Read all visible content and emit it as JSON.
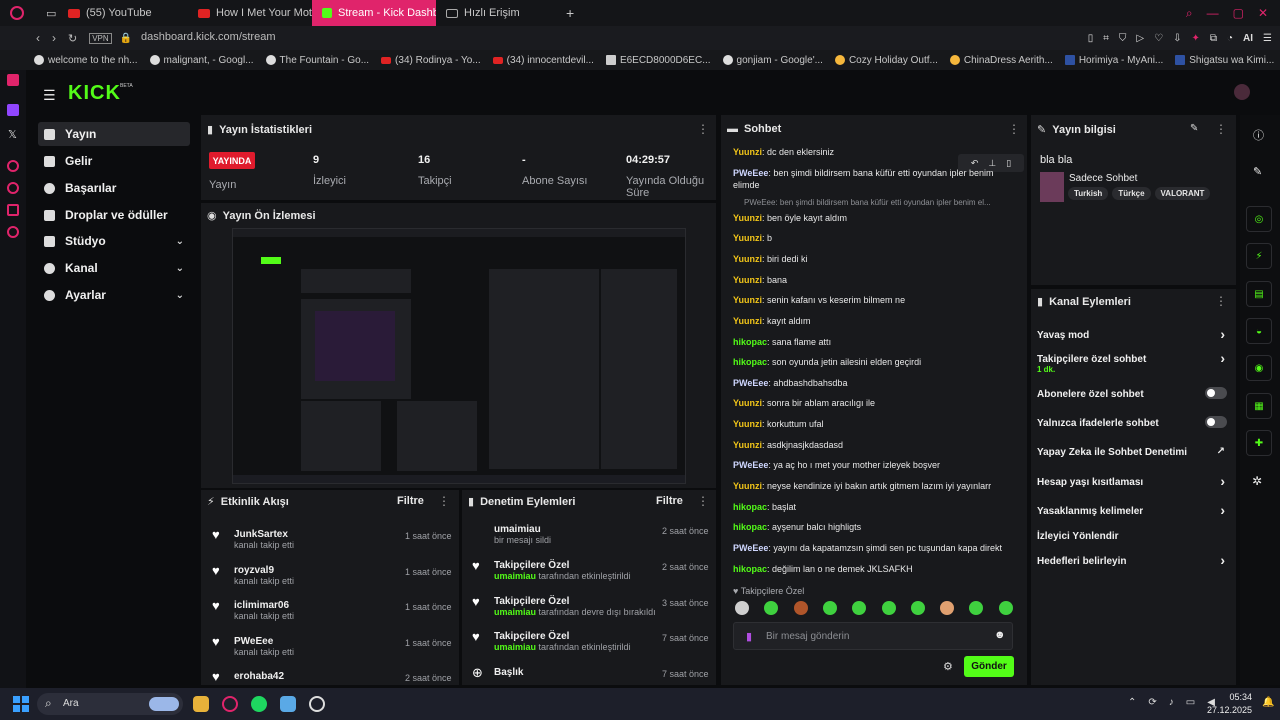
{
  "browser": {
    "tabs": [
      "(55) YouTube",
      "How I Met Your Mother 2...",
      "Stream - Kick Dashbo...",
      "Hızlı Erişim"
    ],
    "url": "dashboard.kick.com/stream",
    "vpn": "VPN",
    "ai": "AI"
  },
  "bookmarks": [
    "welcome to the nh...",
    "malignant, - Googl...",
    "The Fountain - Go...",
    "(34) Rodinya - Yo...",
    "(34) innocentdevil...",
    "E6ECD8000D6EC...",
    "gonjiam - Google'...",
    "Cozy Holiday Outf...",
    "ChinaDress Aerith...",
    "Horimiya - MyAni...",
    "Shigatsu wa Kimi..."
  ],
  "brand": {
    "logo": "KICK",
    "beta": "BETA",
    "accent": "#53fc18"
  },
  "sidebar": {
    "items": [
      {
        "label": "Yayın",
        "icon": "video-icon"
      },
      {
        "label": "Gelir",
        "icon": "chart-icon"
      },
      {
        "label": "Başarılar",
        "icon": "trophy-icon"
      },
      {
        "label": "Droplar ve ödüller",
        "icon": "gift-icon"
      },
      {
        "label": "Stüdyo",
        "icon": "camera-icon"
      },
      {
        "label": "Kanal",
        "icon": "user-icon"
      },
      {
        "label": "Ayarlar",
        "icon": "gear-icon"
      }
    ]
  },
  "stats": {
    "title": "Yayın İstatistikleri",
    "live_badge": "YAYINDA",
    "stream_label": "Yayın",
    "viewers_value": "9",
    "viewers_label": "İzleyici",
    "followers_value": "16",
    "followers_label": "Takipçi",
    "subs_value": "-",
    "subs_label": "Abone Sayısı",
    "duration_value": "04:29:57",
    "duration_label": "Yayında Olduğu Süre"
  },
  "preview": {
    "title": "Yayın Ön İzlemesi"
  },
  "activity": {
    "title": "Etkinlik Akışı",
    "filter": "Filtre",
    "items": [
      {
        "name": "JunkSartex",
        "sub": "kanalı takip etti",
        "time": "1 saat önce"
      },
      {
        "name": "royzval9",
        "sub": "kanalı takip etti",
        "time": "1 saat önce"
      },
      {
        "name": "iclimimar06",
        "sub": "kanalı takip etti",
        "time": "1 saat önce"
      },
      {
        "name": "PWeEee",
        "sub": "kanalı takip etti",
        "time": "1 saat önce"
      },
      {
        "name": "erohaba42",
        "sub": "",
        "time": "2 saat önce"
      }
    ]
  },
  "moderation": {
    "title": "Denetim Eylemleri",
    "filter": "Filtre",
    "items": [
      {
        "name": "umaimiau",
        "sub_user": "",
        "sub": "bir mesajı sildi",
        "time": "2 saat önce"
      },
      {
        "name": "Takipçilere Özel",
        "sub_user": "umaimiau",
        "sub": " tarafından etkinleştirildi",
        "time": "2 saat önce"
      },
      {
        "name": "Takipçilere Özel",
        "sub_user": "umaimiau",
        "sub": " tarafından devre dışı bırakıldı",
        "time": "3 saat önce"
      },
      {
        "name": "Takipçilere Özel",
        "sub_user": "umaimiau",
        "sub": " tarafından etkinleştirildi",
        "time": "7 saat önce"
      },
      {
        "name": "Başlık",
        "sub_user": "",
        "sub": "",
        "time": "7 saat önce"
      }
    ]
  },
  "chat": {
    "title": "Sohbet",
    "reply_preview": "PWeEee: ben şimdi bildirsem bana küfür etti oyundan ipler benim el...",
    "followers_only": "Takipçilere Özel",
    "placeholder": "Bir mesaj gönderin",
    "send": "Gönder",
    "messages": [
      {
        "user": "Yuunzi",
        "color": "y",
        "text": "dc den eklersiniz"
      },
      {
        "user": "PWeEee",
        "color": "w",
        "text": "ben şimdi bildirsem bana küfür etti oyundan ipler benim elimde"
      },
      {
        "user": "Yuunzi",
        "color": "y",
        "text": "ben öyle kayıt aldım"
      },
      {
        "user": "Yuunzi",
        "color": "y",
        "text": "b"
      },
      {
        "user": "Yuunzi",
        "color": "y",
        "text": "biri dedi ki"
      },
      {
        "user": "Yuunzi",
        "color": "y",
        "text": "bana"
      },
      {
        "user": "Yuunzi",
        "color": "y",
        "text": "senin kafanı vs keserim bilmem ne"
      },
      {
        "user": "Yuunzi",
        "color": "y",
        "text": "kayıt aldım"
      },
      {
        "user": "hikopac",
        "color": "g",
        "text": "sana flame attı"
      },
      {
        "user": "hikopac",
        "color": "g",
        "text": "son oyunda jetin ailesini elden geçirdi"
      },
      {
        "user": "PWeEee",
        "color": "w",
        "text": "ahdbashdbahsdba"
      },
      {
        "user": "Yuunzi",
        "color": "y",
        "text": "sonra bir ablam aracılıgı ile"
      },
      {
        "user": "Yuunzi",
        "color": "y",
        "text": "korkuttum ufal"
      },
      {
        "user": "Yuunzi",
        "color": "y",
        "text": "asdkjnasjkdasdasd"
      },
      {
        "user": "PWeEee",
        "color": "w",
        "text": "ya aç ho ı met your mother izleyek boşver"
      },
      {
        "user": "Yuunzi",
        "color": "y",
        "text": "neyse kendinize iyi bakın artık gitmem lazım iyi yayınlarr"
      },
      {
        "user": "hikopac",
        "color": "g",
        "text": "başlat"
      },
      {
        "user": "hikopac",
        "color": "g",
        "text": "ayşenur balcı highligts"
      },
      {
        "user": "PWeEee",
        "color": "w",
        "text": "yayını da kapatamzsın şimdi sen pc tuşundan kapa direkt"
      },
      {
        "user": "hikopac",
        "color": "g",
        "text": "değilim lan o ne demek JKLSAFKH"
      }
    ]
  },
  "stream_info": {
    "title": "Yayın bilgisi",
    "stream_title": "bla bla",
    "category": "Sadece Sohbet",
    "tags": [
      "Turkish",
      "Türkçe",
      "VALORANT"
    ]
  },
  "channel_actions": {
    "title": "Kanal Eylemleri",
    "items": [
      {
        "label": "Yavaş mod",
        "sub": "",
        "kind": "chevron"
      },
      {
        "label": "Takipçilere özel sohbet",
        "sub": "1 dk.",
        "kind": "chevron"
      },
      {
        "label": "Abonelere özel sohbet",
        "sub": "",
        "kind": "toggle"
      },
      {
        "label": "Yalnızca ifadelerle sohbet",
        "sub": "",
        "kind": "toggle"
      },
      {
        "label": "Yapay Zeka ile Sohbet Denetimi",
        "sub": "",
        "kind": "external"
      },
      {
        "label": "Hesap yaşı kısıtlaması",
        "sub": "",
        "kind": "chevron"
      },
      {
        "label": "Yasaklanmış kelimeler",
        "sub": "",
        "kind": "chevron"
      },
      {
        "label": "İzleyici Yönlendir",
        "sub": "",
        "kind": "none"
      },
      {
        "label": "Hedefleri belirleyin",
        "sub": "",
        "kind": "chevron"
      }
    ]
  },
  "taskbar": {
    "search": "Ara",
    "time": "05:34",
    "date": "27.12.2025"
  }
}
